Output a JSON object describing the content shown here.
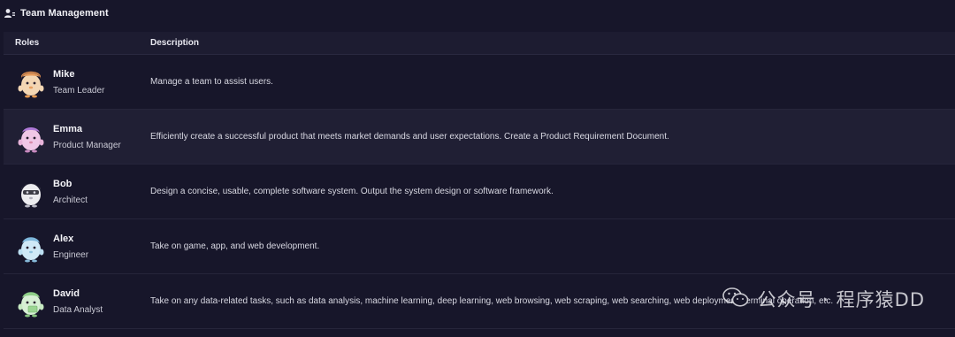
{
  "header": {
    "title": "Team Management",
    "icon": "team-icon"
  },
  "table": {
    "columns": {
      "roles": "Roles",
      "description": "Description"
    },
    "rows": [
      {
        "name": "Mike",
        "role": "Team Leader",
        "description": "Manage a team to assist users.",
        "avatar": "mike-avatar"
      },
      {
        "name": "Emma",
        "role": "Product Manager",
        "description": "Efficiently create a successful product that meets market demands and user expectations. Create a Product Requirement Document.",
        "avatar": "emma-avatar"
      },
      {
        "name": "Bob",
        "role": "Architect",
        "description": "Design a concise, usable, complete software system. Output the system design or software framework.",
        "avatar": "bob-avatar"
      },
      {
        "name": "Alex",
        "role": "Engineer",
        "description": "Take on game, app, and web development.",
        "avatar": "alex-avatar"
      },
      {
        "name": "David",
        "role": "Data Analyst",
        "description": "Take on any data-related tasks, such as data analysis, machine learning, deep learning, web browsing, web scraping, web searching, web deployment, terminal operation, etc.",
        "avatar": "david-avatar"
      }
    ]
  },
  "watermark": {
    "text": "公众号 · 程序猿DD"
  },
  "colors": {
    "background": "#17162a",
    "highlight_row": "#201f34",
    "header_row": "#1d1c31"
  }
}
